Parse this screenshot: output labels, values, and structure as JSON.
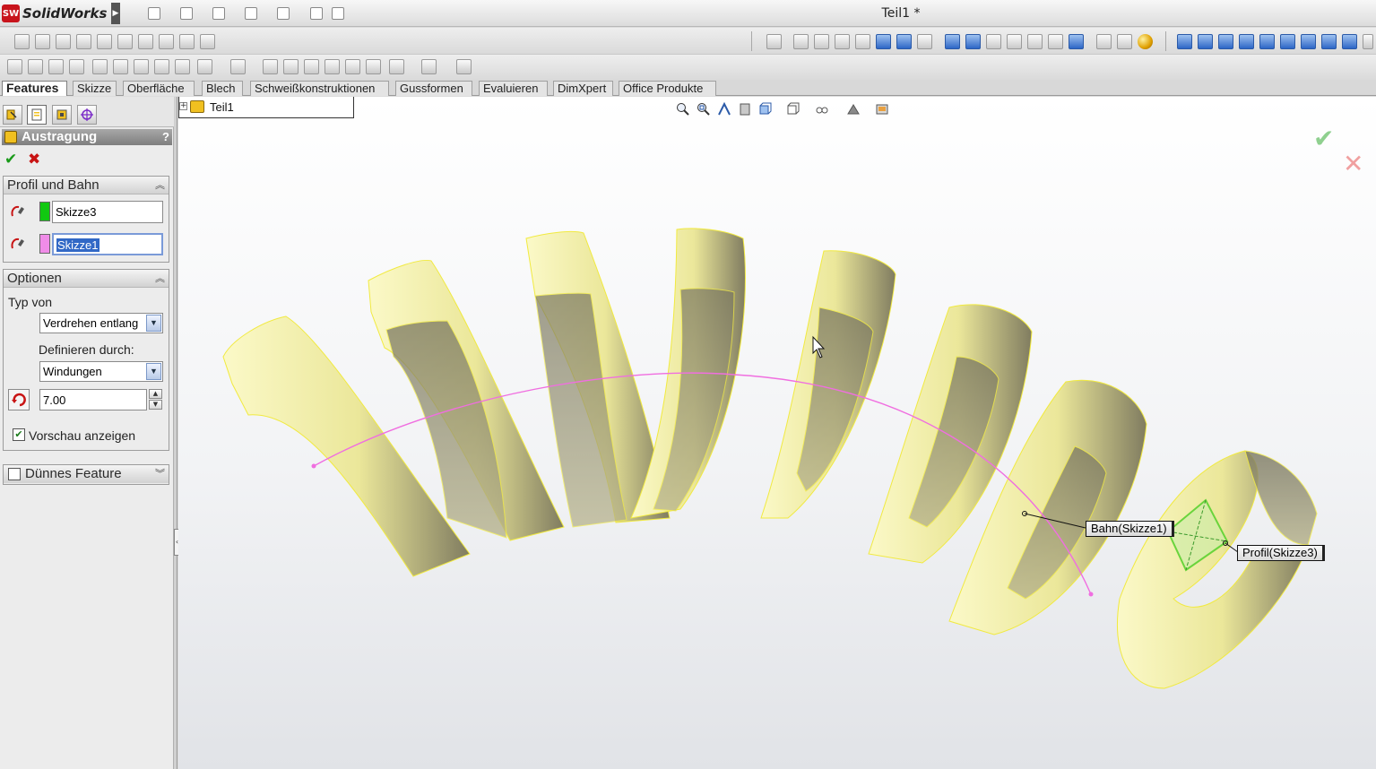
{
  "app": {
    "name": "SolidWorks",
    "logo_badge": "SW",
    "document_title": "Teil1 *"
  },
  "command_tabs": [
    {
      "label": "Features",
      "active": true
    },
    {
      "label": "Skizze"
    },
    {
      "label": "Oberfläche"
    },
    {
      "label": "Blech"
    },
    {
      "label": "Schweißkonstruktionen"
    },
    {
      "label": "Gussformen"
    },
    {
      "label": "Evaluieren"
    },
    {
      "label": "DimXpert"
    },
    {
      "label": "Office Produkte"
    }
  ],
  "feature_tree": {
    "root": "Teil1",
    "expand_symbol": "+"
  },
  "property_manager": {
    "title": "Austragung",
    "help_symbol": "?",
    "ok_symbol": "✔",
    "cancel_symbol": "✖",
    "profile_path": {
      "header": "Profil und Bahn",
      "profile": {
        "value": "Skizze3",
        "color": "#11c811"
      },
      "path": {
        "value": "Skizze1",
        "color": "#f08ce8",
        "selected": true
      }
    },
    "options": {
      "header": "Optionen",
      "type_label": "Typ von",
      "type_value": "Verdrehen entlang",
      "define_label": "Definieren durch:",
      "define_value": "Windungen",
      "turns_value": "7.00",
      "preview_label": "Vorschau anzeigen",
      "preview_checked": true
    },
    "thin_feature": {
      "header": "Dünnes Feature",
      "checked": false
    }
  },
  "viewport": {
    "callout_path": "Bahn(Skizze1)",
    "callout_profile": "Profil(Skizze3)",
    "ok_symbol": "✔",
    "cancel_symbol": "✕",
    "min_symbol": "–",
    "spring_color": "#f5f2a0",
    "path_color": "#f06ee0",
    "profile_color": "#6ad43c"
  },
  "colors": {
    "selection_blue": "#3168c6",
    "tab_bg": "#d8d8d8",
    "header_grey": "#8a8a8a"
  }
}
